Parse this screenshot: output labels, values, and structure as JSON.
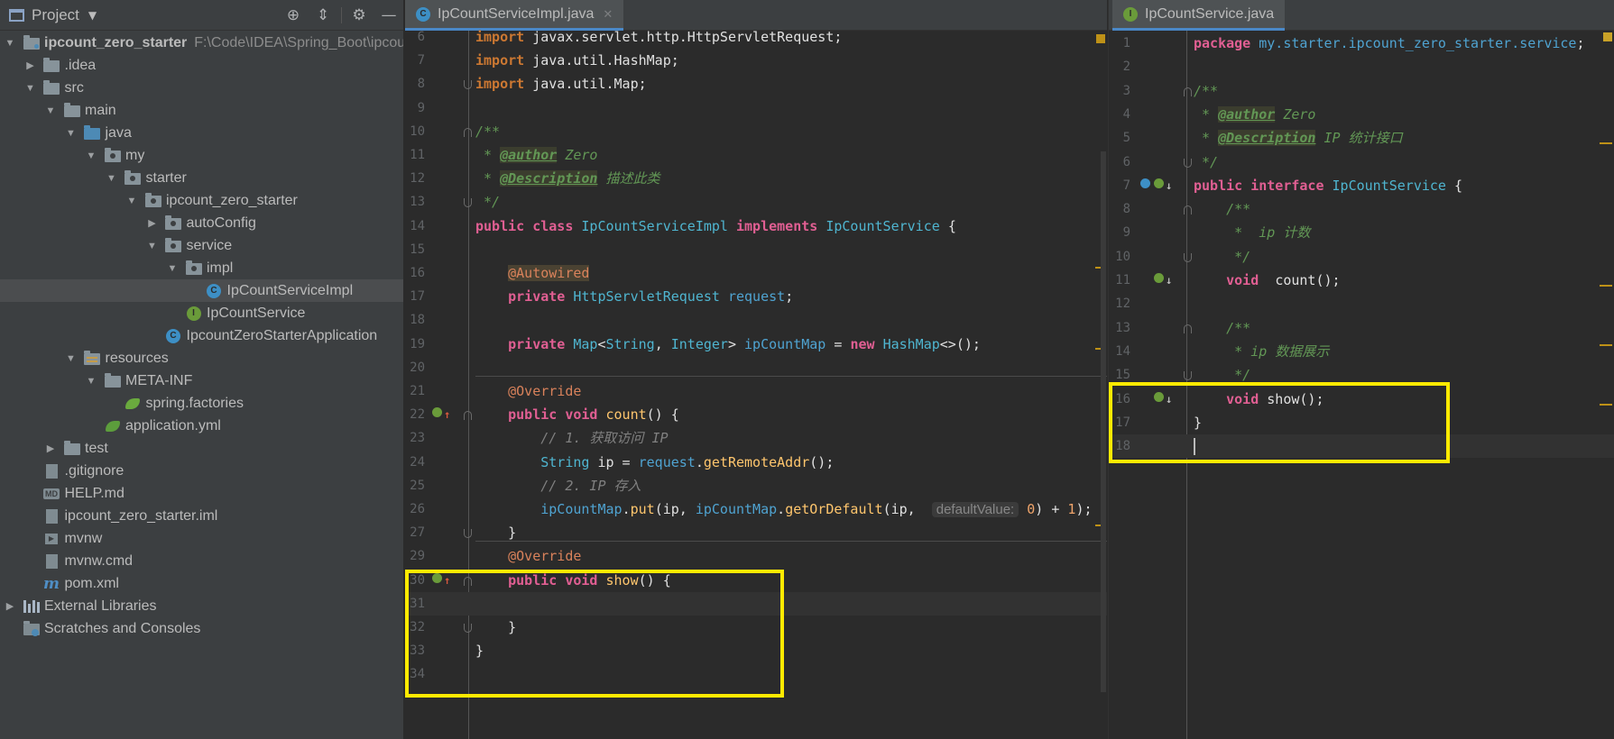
{
  "project_panel": {
    "title": "Project",
    "caret": "▼",
    "tree": [
      {
        "label": "ipcount_zero_starter",
        "path": "F:\\Code\\IDEA\\Spring_Boot\\ipcount",
        "depth": 0,
        "arrow": "▼",
        "icon": "module-folder",
        "bold": true
      },
      {
        "label": ".idea",
        "depth": 1,
        "arrow": "▶",
        "icon": "folder"
      },
      {
        "label": "src",
        "depth": 1,
        "arrow": "▼",
        "icon": "folder"
      },
      {
        "label": "main",
        "depth": 2,
        "arrow": "▼",
        "icon": "folder"
      },
      {
        "label": "java",
        "depth": 3,
        "arrow": "▼",
        "icon": "source-folder"
      },
      {
        "label": "my",
        "depth": 4,
        "arrow": "▼",
        "icon": "package"
      },
      {
        "label": "starter",
        "depth": 5,
        "arrow": "▼",
        "icon": "package"
      },
      {
        "label": "ipcount_zero_starter",
        "depth": 6,
        "arrow": "▼",
        "icon": "package"
      },
      {
        "label": "autoConfig",
        "depth": 7,
        "arrow": "▶",
        "icon": "package"
      },
      {
        "label": "service",
        "depth": 7,
        "arrow": "▼",
        "icon": "package"
      },
      {
        "label": "impl",
        "depth": 8,
        "arrow": "▼",
        "icon": "package"
      },
      {
        "label": "IpCountServiceImpl",
        "depth": 9,
        "arrow": "",
        "icon": "class",
        "selected": true
      },
      {
        "label": "IpCountService",
        "depth": 8,
        "arrow": "",
        "icon": "interface"
      },
      {
        "label": "IpcountZeroStarterApplication",
        "depth": 7,
        "arrow": "",
        "icon": "spring-class"
      },
      {
        "label": "resources",
        "depth": 3,
        "arrow": "▼",
        "icon": "resources-folder"
      },
      {
        "label": "META-INF",
        "depth": 4,
        "arrow": "▼",
        "icon": "folder"
      },
      {
        "label": "spring.factories",
        "depth": 5,
        "arrow": "",
        "icon": "spring-factories"
      },
      {
        "label": "application.yml",
        "depth": 4,
        "arrow": "",
        "icon": "yml"
      },
      {
        "label": "test",
        "depth": 2,
        "arrow": "▶",
        "icon": "folder"
      },
      {
        "label": ".gitignore",
        "depth": 1,
        "arrow": "",
        "icon": "file"
      },
      {
        "label": "HELP.md",
        "depth": 1,
        "arrow": "",
        "icon": "md"
      },
      {
        "label": "ipcount_zero_starter.iml",
        "depth": 1,
        "arrow": "",
        "icon": "file"
      },
      {
        "label": "mvnw",
        "depth": 1,
        "arrow": "",
        "icon": "terminal"
      },
      {
        "label": "mvnw.cmd",
        "depth": 1,
        "arrow": "",
        "icon": "file"
      },
      {
        "label": "pom.xml",
        "depth": 1,
        "arrow": "",
        "icon": "maven"
      },
      {
        "label": "External Libraries",
        "depth": 0,
        "arrow": "▶",
        "icon": "libraries"
      },
      {
        "label": "Scratches and Consoles",
        "depth": 0,
        "arrow": "",
        "icon": "scratches"
      }
    ]
  },
  "editor_left": {
    "tab": {
      "label": "IpCountServiceImpl.java",
      "icon_letter": "C",
      "close": "✕"
    },
    "lines": [
      {
        "n": "6",
        "tokens": [
          [
            "kw",
            "import "
          ],
          [
            "plain",
            "javax.servlet.http.HttpServletRequest;"
          ]
        ]
      },
      {
        "n": "7",
        "tokens": [
          [
            "kw",
            "import "
          ],
          [
            "plain",
            "java.util.HashMap;"
          ]
        ]
      },
      {
        "n": "8",
        "tokens": [
          [
            "kw",
            "import "
          ],
          [
            "plain",
            "java.util.Map;"
          ]
        ],
        "fold": "down"
      },
      {
        "n": "9",
        "tokens": []
      },
      {
        "n": "10",
        "tokens": [
          [
            "jd",
            "/**"
          ]
        ],
        "fold": "up"
      },
      {
        "n": "11",
        "tokens": [
          [
            "jd",
            " * "
          ],
          [
            "jdtag",
            "@author"
          ],
          [
            "jd",
            " Zero"
          ]
        ]
      },
      {
        "n": "12",
        "tokens": [
          [
            "jd",
            " * "
          ],
          [
            "jdtag",
            "@Description"
          ],
          [
            "jd",
            " 描述此类"
          ]
        ]
      },
      {
        "n": "13",
        "tokens": [
          [
            "jd",
            " */"
          ]
        ],
        "fold": "down"
      },
      {
        "n": "14",
        "tokens": [
          [
            "kwp",
            "public class "
          ],
          [
            "cls",
            "IpCountServiceImpl "
          ],
          [
            "kwp",
            "implements "
          ],
          [
            "cls",
            "IpCountService "
          ],
          [
            "plain",
            "{"
          ]
        ]
      },
      {
        "n": "15",
        "tokens": []
      },
      {
        "n": "16",
        "tokens": [
          [
            "plain",
            "    "
          ],
          [
            "ann-hl",
            "@Autowired"
          ]
        ]
      },
      {
        "n": "17",
        "tokens": [
          [
            "plain",
            "    "
          ],
          [
            "kwp",
            "private "
          ],
          [
            "cls",
            "HttpServletRequest "
          ],
          [
            "fld",
            "request"
          ],
          [
            "plain",
            ";"
          ]
        ]
      },
      {
        "n": "18",
        "tokens": []
      },
      {
        "n": "19",
        "tokens": [
          [
            "plain",
            "    "
          ],
          [
            "kwp",
            "private "
          ],
          [
            "cls",
            "Map"
          ],
          [
            "plain",
            "<"
          ],
          [
            "cls",
            "String"
          ],
          [
            "plain",
            ", "
          ],
          [
            "cls",
            "Integer"
          ],
          [
            "plain",
            "> "
          ],
          [
            "fld",
            "ipCountMap "
          ],
          [
            "plain",
            "= "
          ],
          [
            "kwp",
            "new "
          ],
          [
            "cls",
            "HashMap"
          ],
          [
            "plain",
            "<>();"
          ]
        ]
      },
      {
        "n": "20",
        "tokens": []
      },
      {
        "n": "21",
        "tokens": [
          [
            "plain",
            "    "
          ],
          [
            "ann",
            "@Override"
          ]
        ],
        "sep_above": true
      },
      {
        "n": "22",
        "tokens": [
          [
            "plain",
            "    "
          ],
          [
            "kwp",
            "public void "
          ],
          [
            "mth",
            "count"
          ],
          [
            "plain",
            "() {"
          ]
        ],
        "fold": "up",
        "gutter_icon": "implements-up"
      },
      {
        "n": "23",
        "tokens": [
          [
            "plain",
            "        "
          ],
          [
            "cm",
            "// 1. 获取访问 IP"
          ]
        ]
      },
      {
        "n": "24",
        "tokens": [
          [
            "plain",
            "        "
          ],
          [
            "cls",
            "String "
          ],
          [
            "plain",
            "ip = "
          ],
          [
            "fld",
            "request"
          ],
          [
            "plain",
            "."
          ],
          [
            "mth",
            "getRemoteAddr"
          ],
          [
            "plain",
            "();"
          ]
        ]
      },
      {
        "n": "25",
        "tokens": [
          [
            "plain",
            "        "
          ],
          [
            "cm",
            "// 2. IP 存入"
          ]
        ]
      },
      {
        "n": "26",
        "tokens": [
          [
            "plain",
            "        "
          ],
          [
            "fld",
            "ipCountMap"
          ],
          [
            "plain",
            "."
          ],
          [
            "mth",
            "put"
          ],
          [
            "plain",
            "(ip, "
          ],
          [
            "fld",
            "ipCountMap"
          ],
          [
            "plain",
            "."
          ],
          [
            "mth",
            "getOrDefault"
          ],
          [
            "plain",
            "(ip,  "
          ],
          [
            "hint",
            "defaultValue:"
          ],
          [
            "plain",
            " "
          ],
          [
            "num",
            "0"
          ],
          [
            "plain",
            ") + "
          ],
          [
            "num",
            "1"
          ],
          [
            "plain",
            ");"
          ]
        ]
      },
      {
        "n": "27",
        "tokens": [
          [
            "plain",
            "    }"
          ]
        ],
        "fold": "down"
      },
      {
        "n": "29",
        "tokens": [
          [
            "plain",
            "    "
          ],
          [
            "ann",
            "@Override"
          ]
        ],
        "sep_above": true
      },
      {
        "n": "30",
        "tokens": [
          [
            "plain",
            "    "
          ],
          [
            "kwp",
            "public void "
          ],
          [
            "mth",
            "show"
          ],
          [
            "plain",
            "() {"
          ]
        ],
        "fold": "up",
        "gutter_icon": "implements-up"
      },
      {
        "n": "31",
        "tokens": [],
        "current": true
      },
      {
        "n": "32",
        "tokens": [
          [
            "plain",
            "    }"
          ]
        ],
        "fold": "down"
      },
      {
        "n": "33",
        "tokens": [
          [
            "plain",
            "}"
          ]
        ]
      },
      {
        "n": "34",
        "tokens": []
      }
    ]
  },
  "editor_right": {
    "tab": {
      "label": "IpCountService.java",
      "icon_letter": "I"
    },
    "lines": [
      {
        "n": "1",
        "tokens": [
          [
            "kwp",
            "package "
          ],
          [
            "fld",
            "my.starter.ipcount_zero_starter.service"
          ],
          [
            "plain",
            ";"
          ]
        ]
      },
      {
        "n": "2",
        "tokens": []
      },
      {
        "n": "3",
        "tokens": [
          [
            "jd",
            "/**"
          ]
        ],
        "fold": "up"
      },
      {
        "n": "4",
        "tokens": [
          [
            "jd",
            " * "
          ],
          [
            "jdtag",
            "@author"
          ],
          [
            "jd",
            " Zero"
          ]
        ]
      },
      {
        "n": "5",
        "tokens": [
          [
            "jd",
            " * "
          ],
          [
            "jdtag",
            "@Description"
          ],
          [
            "jd",
            " IP 统计接口"
          ]
        ]
      },
      {
        "n": "6",
        "tokens": [
          [
            "jd",
            " */"
          ]
        ],
        "fold": "down"
      },
      {
        "n": "7",
        "tokens": [
          [
            "kwp",
            "public interface "
          ],
          [
            "cls",
            "IpCountService "
          ],
          [
            "plain",
            "{"
          ]
        ],
        "gutter_icon": "implemented-down-spring"
      },
      {
        "n": "8",
        "tokens": [
          [
            "plain",
            "    "
          ],
          [
            "jd",
            "/**"
          ]
        ],
        "fold": "up"
      },
      {
        "n": "9",
        "tokens": [
          [
            "plain",
            "    "
          ],
          [
            "jd",
            " *  ip 计数"
          ]
        ]
      },
      {
        "n": "10",
        "tokens": [
          [
            "plain",
            "    "
          ],
          [
            "jd",
            " */"
          ]
        ],
        "fold": "down"
      },
      {
        "n": "11",
        "tokens": [
          [
            "plain",
            "    "
          ],
          [
            "kwp",
            "void  "
          ],
          [
            "plain",
            "count();"
          ]
        ],
        "gutter_icon": "implemented-down"
      },
      {
        "n": "12",
        "tokens": []
      },
      {
        "n": "13",
        "tokens": [
          [
            "plain",
            "    "
          ],
          [
            "jd",
            "/**"
          ]
        ],
        "fold": "up"
      },
      {
        "n": "14",
        "tokens": [
          [
            "plain",
            "    "
          ],
          [
            "jd",
            " * ip 数据展示"
          ]
        ]
      },
      {
        "n": "15",
        "tokens": [
          [
            "plain",
            "    "
          ],
          [
            "jd",
            " */"
          ]
        ],
        "fold": "down"
      },
      {
        "n": "16",
        "tokens": [
          [
            "plain",
            "    "
          ],
          [
            "kwp",
            "void "
          ],
          [
            "plain",
            "show();"
          ]
        ],
        "gutter_icon": "implemented-down"
      },
      {
        "n": "17",
        "tokens": [
          [
            "plain",
            "}"
          ]
        ]
      },
      {
        "n": "18",
        "tokens": [],
        "current": true,
        "cursor": true
      }
    ]
  },
  "colors": {
    "highlight_box": "#ffea00",
    "accent": "#4a88c7",
    "background": "#2b2b2b",
    "panel": "#3c3f41"
  }
}
